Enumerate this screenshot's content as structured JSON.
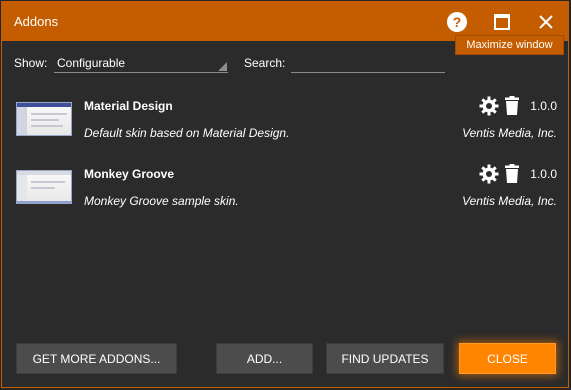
{
  "window": {
    "title": "Addons",
    "help_icon": "help-circle-icon",
    "maximize_icon": "maximize-icon",
    "close_icon": "close-icon",
    "tooltip": "Maximize window",
    "accent_color": "#c45d00"
  },
  "filters": {
    "show_label": "Show:",
    "show_value": "Configurable",
    "search_label": "Search:",
    "search_value": ""
  },
  "addons": [
    {
      "name": "Material Design",
      "description": "Default skin based on Material Design.",
      "version": "1.0.0",
      "author": "Ventis Media, Inc.",
      "settings_icon": "gear-icon",
      "delete_icon": "trash-icon"
    },
    {
      "name": "Monkey Groove",
      "description": "Monkey Groove sample skin.",
      "version": "1.0.0",
      "author": "Ventis Media, Inc.",
      "settings_icon": "gear-icon",
      "delete_icon": "trash-icon"
    }
  ],
  "buttons": {
    "get_more": "GET MORE ADDONS...",
    "add": "ADD...",
    "find_updates": "FIND UPDATES",
    "close": "CLOSE",
    "primary_color": "#ff8500"
  }
}
